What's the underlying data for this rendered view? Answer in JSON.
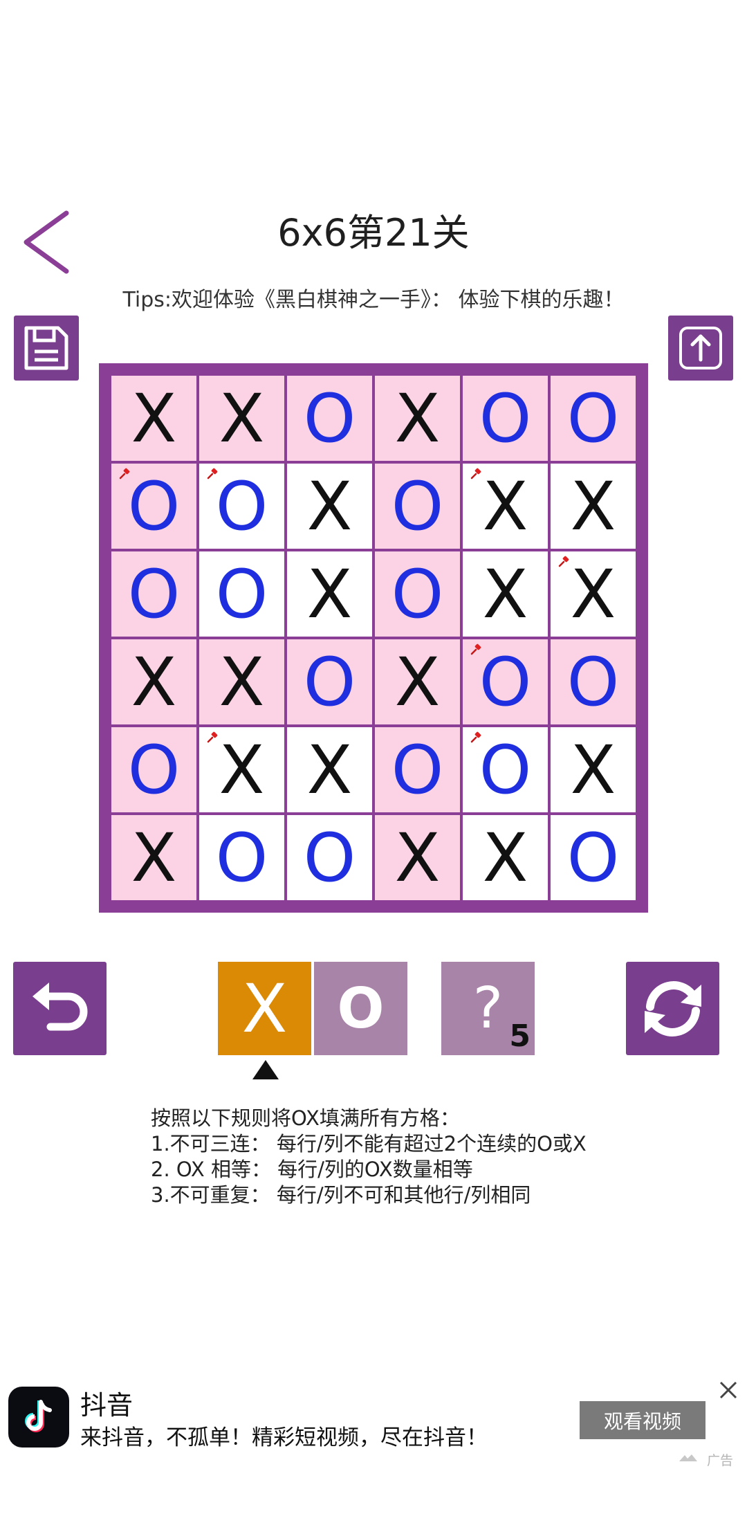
{
  "header": {
    "title": "6x6第21关",
    "tips": "Tips:欢迎体验《黑白棋神之一手》： 体验下棋的乐趣！"
  },
  "board": {
    "rows": [
      [
        {
          "mark": "X",
          "bg": "pink",
          "fixed": false
        },
        {
          "mark": "X",
          "bg": "pink",
          "fixed": false
        },
        {
          "mark": "O",
          "bg": "pink",
          "fixed": false
        },
        {
          "mark": "X",
          "bg": "pink",
          "fixed": false
        },
        {
          "mark": "O",
          "bg": "pink",
          "fixed": false
        },
        {
          "mark": "O",
          "bg": "pink",
          "fixed": false
        }
      ],
      [
        {
          "mark": "O",
          "bg": "pink",
          "fixed": true
        },
        {
          "mark": "O",
          "bg": "white",
          "fixed": true
        },
        {
          "mark": "X",
          "bg": "white",
          "fixed": false
        },
        {
          "mark": "O",
          "bg": "pink",
          "fixed": false
        },
        {
          "mark": "X",
          "bg": "white",
          "fixed": true
        },
        {
          "mark": "X",
          "bg": "white",
          "fixed": false
        }
      ],
      [
        {
          "mark": "O",
          "bg": "pink",
          "fixed": false
        },
        {
          "mark": "O",
          "bg": "white",
          "fixed": false
        },
        {
          "mark": "X",
          "bg": "white",
          "fixed": false
        },
        {
          "mark": "O",
          "bg": "pink",
          "fixed": false
        },
        {
          "mark": "X",
          "bg": "white",
          "fixed": false
        },
        {
          "mark": "X",
          "bg": "white",
          "fixed": true
        }
      ],
      [
        {
          "mark": "X",
          "bg": "pink",
          "fixed": false
        },
        {
          "mark": "X",
          "bg": "pink",
          "fixed": false
        },
        {
          "mark": "O",
          "bg": "pink",
          "fixed": false
        },
        {
          "mark": "X",
          "bg": "pink",
          "fixed": false
        },
        {
          "mark": "O",
          "bg": "pink",
          "fixed": true
        },
        {
          "mark": "O",
          "bg": "pink",
          "fixed": false
        }
      ],
      [
        {
          "mark": "O",
          "bg": "pink",
          "fixed": false
        },
        {
          "mark": "X",
          "bg": "white",
          "fixed": true
        },
        {
          "mark": "X",
          "bg": "white",
          "fixed": false
        },
        {
          "mark": "O",
          "bg": "pink",
          "fixed": false
        },
        {
          "mark": "O",
          "bg": "white",
          "fixed": true
        },
        {
          "mark": "X",
          "bg": "white",
          "fixed": false
        }
      ],
      [
        {
          "mark": "X",
          "bg": "pink",
          "fixed": false
        },
        {
          "mark": "O",
          "bg": "white",
          "fixed": false
        },
        {
          "mark": "O",
          "bg": "white",
          "fixed": false
        },
        {
          "mark": "X",
          "bg": "pink",
          "fixed": false
        },
        {
          "mark": "X",
          "bg": "white",
          "fixed": false
        },
        {
          "mark": "O",
          "bg": "white",
          "fixed": false
        }
      ]
    ]
  },
  "controls": {
    "select_x_label": "X",
    "select_o_label": "O",
    "selected": "X",
    "hint_label": "?",
    "hint_count": "5"
  },
  "rules": [
    "按照以下规则将OX填满所有方格：",
    "1.不可三连：  每行/列不能有超过2个连续的O或X",
    "2. OX 相等：  每行/列的OX数量相等",
    "3.不可重复：  每行/列不可和其他行/列相同"
  ],
  "ad": {
    "app_name": "抖音",
    "description": "来抖音，不孤单！精彩短视频，尽在抖音！",
    "button_label": "观看视频",
    "tag": "广告"
  },
  "colors": {
    "accent_purple": "#7a3e8f",
    "board_border": "#8a3e95",
    "cell_pink": "#fbd3e4",
    "o_blue": "#1f2fe0",
    "selected_orange": "#db8a06",
    "inactive_mauve": "#a784a8"
  },
  "icons": {
    "back": "chevron-left-icon",
    "save": "floppy-disk-icon",
    "share": "upload-icon",
    "undo": "undo-icon",
    "refresh": "refresh-icon",
    "fixed_cell": "pin-icon",
    "close_ad": "close-icon"
  }
}
